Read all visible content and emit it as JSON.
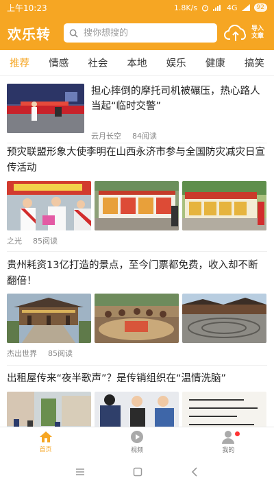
{
  "status": {
    "time": "上午10:23",
    "speed": "1.8K/s",
    "network": "4G",
    "battery": "92"
  },
  "header": {
    "app_title": "欢乐转",
    "search_placeholder": "搜你想搜的",
    "import_label": "导入文章"
  },
  "tabs": [
    {
      "label": "推荐",
      "active": true
    },
    {
      "label": "情感",
      "active": false
    },
    {
      "label": "社会",
      "active": false
    },
    {
      "label": "本地",
      "active": false
    },
    {
      "label": "娱乐",
      "active": false
    },
    {
      "label": "健康",
      "active": false
    },
    {
      "label": "搞笑",
      "active": false
    }
  ],
  "articles": [
    {
      "title": "担心摔倒的摩托司机被碾压，热心路人当起“临时交警”",
      "source": "云月长空",
      "reads": "84阅读"
    },
    {
      "title": "预灾联盟形象大使李明在山西永济市参与全国防灾减灾日宣传活动",
      "source": "之光",
      "reads": "85阅读"
    },
    {
      "title": "贵州耗资13亿打造的景点，至今门票都免费，收入却不断翻倍！",
      "source": "杰出世界",
      "reads": "85阅读"
    },
    {
      "title": "出租屋传来“夜半歌声”？是传销组织在“温情洗脑”"
    }
  ],
  "bottom_nav": [
    {
      "label": "首页",
      "icon": "home-icon",
      "active": true
    },
    {
      "label": "视频",
      "icon": "video-play-icon",
      "active": false
    },
    {
      "label": "我的",
      "icon": "profile-icon",
      "active": false
    }
  ],
  "colors": {
    "accent": "#f6a623",
    "text": "#222222",
    "meta": "#888888"
  }
}
